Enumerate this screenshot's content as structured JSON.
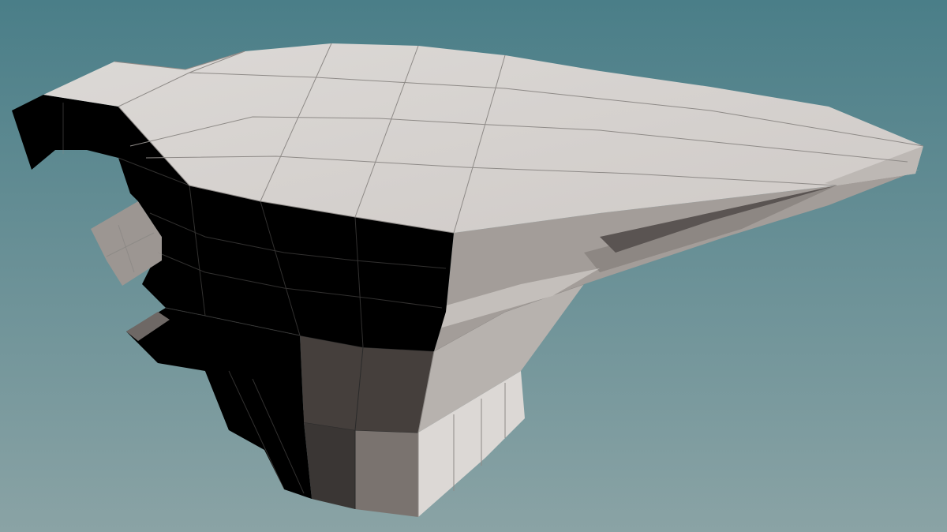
{
  "scene": {
    "subject": "low-poly-anvil-mesh",
    "colors": {
      "background_top": "#4a7e88",
      "background_bottom": "#8aa3a5",
      "face_top": "#d6d3d0",
      "face_light": "#b9b4b0",
      "face_mid": "#9c9692",
      "face_shadow": "#6f6965",
      "face_dark": "#3f3b39",
      "face_black": "#000000",
      "wire": "#8e8a87"
    }
  }
}
